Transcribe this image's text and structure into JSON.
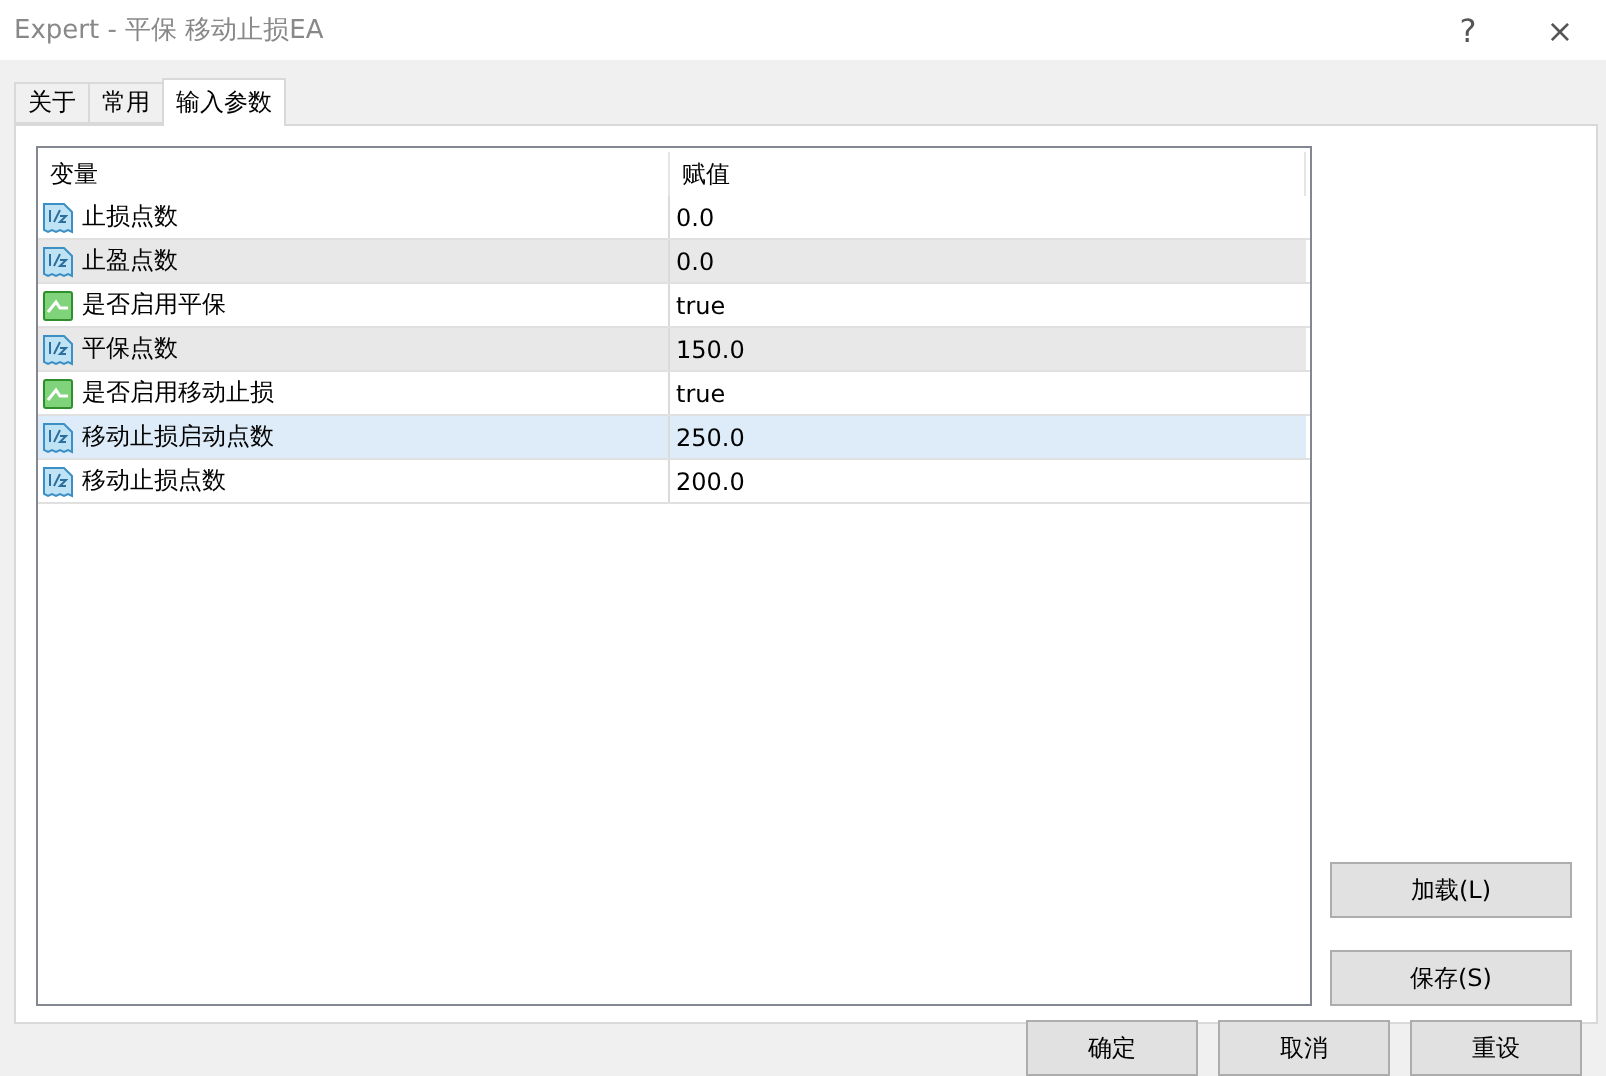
{
  "window": {
    "title": "Expert - 平保 移动止损EA",
    "help": "?",
    "close": "×"
  },
  "tabs": [
    {
      "label": "关于",
      "selected": false
    },
    {
      "label": "常用",
      "selected": false
    },
    {
      "label": "输入参数",
      "selected": true
    }
  ],
  "table": {
    "columns": [
      "变量",
      "赋值"
    ],
    "rows": [
      {
        "kind": "number",
        "name": "止损点数",
        "value": "0.0",
        "selected": false
      },
      {
        "kind": "number",
        "name": "止盈点数",
        "value": "0.0",
        "selected": false
      },
      {
        "kind": "bool",
        "name": "是否启用平保",
        "value": "true",
        "selected": false
      },
      {
        "kind": "number",
        "name": "平保点数",
        "value": "150.0",
        "selected": false
      },
      {
        "kind": "bool",
        "name": "是否启用移动止损",
        "value": "true",
        "selected": false
      },
      {
        "kind": "number",
        "name": "移动止损启动点数",
        "value": "250.0",
        "selected": true
      },
      {
        "kind": "number",
        "name": "移动止损点数",
        "value": "200.0",
        "selected": false
      }
    ]
  },
  "side_buttons": [
    "加载(L)",
    "保存(S)"
  ],
  "buttons": [
    "确定",
    "取消",
    "重设"
  ]
}
